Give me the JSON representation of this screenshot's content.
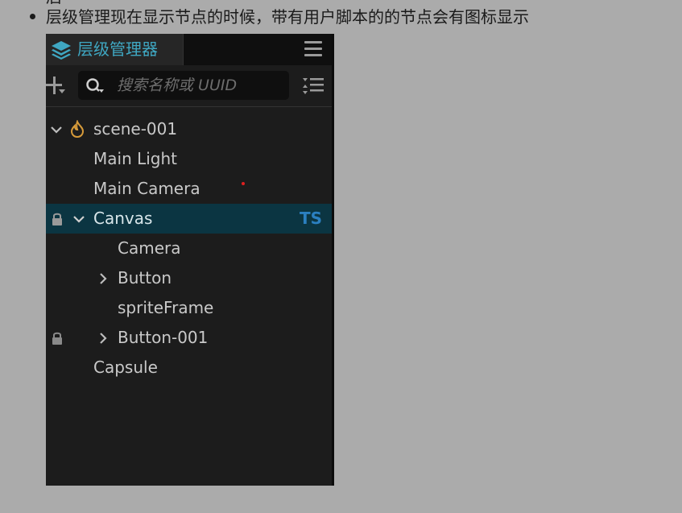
{
  "doc": {
    "top_fragment": "后",
    "bullet_text": "层级管理现在显示节点的时候，带有用户脚本的的节点会有图标显示"
  },
  "panel": {
    "tab_title": "层级管理器",
    "tab_icon": "layers-icon",
    "menu_icon": "hamburger-menu-icon",
    "accent_color": "#3fa7c2",
    "search": {
      "placeholder": "搜索名称或 UUID",
      "value": ""
    },
    "tree": {
      "scene": "scene-001",
      "main_light": "Main Light",
      "main_camera": "Main Camera",
      "canvas": "Canvas",
      "canvas_badge": "TS",
      "camera": "Camera",
      "button": "Button",
      "sprite_frame": "spriteFrame",
      "button_001": "Button-001",
      "capsule": "Capsule"
    },
    "selected_color": "#0b3542",
    "ts_badge_color": "#2b7fc0"
  }
}
